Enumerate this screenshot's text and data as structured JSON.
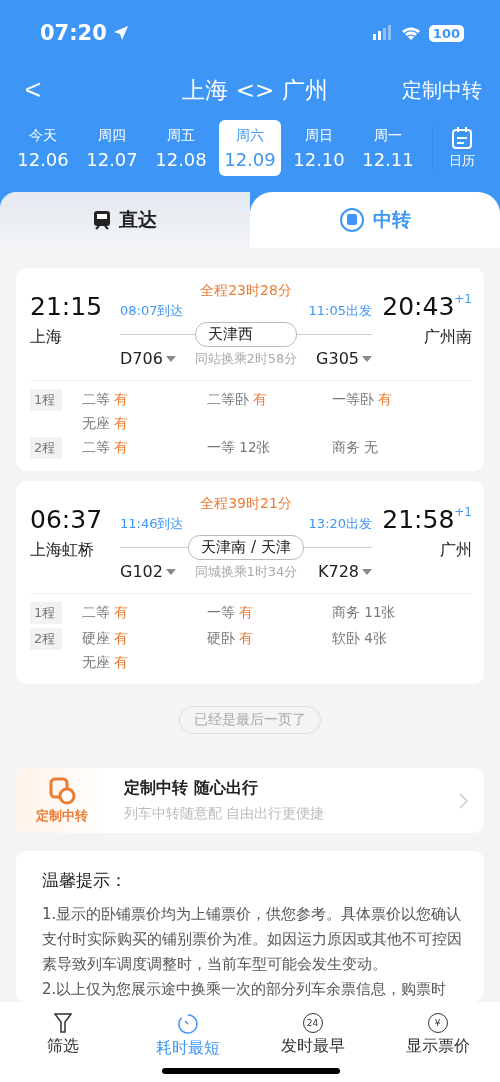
{
  "status_bar": {
    "time": "07:20",
    "battery": "100"
  },
  "header": {
    "back": "<",
    "title": "上海 <> 广州",
    "action": "定制中转"
  },
  "dates": [
    {
      "weekday": "今天",
      "date": "12.06",
      "selected": false
    },
    {
      "weekday": "周四",
      "date": "12.07",
      "selected": false
    },
    {
      "weekday": "周五",
      "date": "12.08",
      "selected": false
    },
    {
      "weekday": "周六",
      "date": "12.09",
      "selected": true
    },
    {
      "weekday": "周日",
      "date": "12.10",
      "selected": false
    },
    {
      "weekday": "周一",
      "date": "12.11",
      "selected": false
    }
  ],
  "calendar": {
    "label": "日历"
  },
  "tabs": [
    {
      "label": "直达",
      "selected": false
    },
    {
      "label": "中转",
      "selected": true
    }
  ],
  "trips": [
    {
      "depart_time": "21:15",
      "depart_station": "上海",
      "arrive_time": "20:43",
      "day_offset": "+1",
      "arrive_station": "广州南",
      "total": "全程23时28分",
      "leg1_arrive": "08:07到达",
      "leg1_train": "D706",
      "transfer_station": "天津西",
      "leg2_depart": "11:05出发",
      "leg2_train": "G305",
      "transfer_note": "同站换乘2时58分",
      "legs": [
        {
          "label": "1程",
          "seats": [
            {
              "class": "二等",
              "status": "有",
              "available": true
            },
            {
              "class": "二等卧",
              "status": "有",
              "available": true
            },
            {
              "class": "一等卧",
              "status": "有",
              "available": true
            },
            {
              "class": "无座",
              "status": "有",
              "available": true
            }
          ]
        },
        {
          "label": "2程",
          "seats": [
            {
              "class": "二等",
              "status": "有",
              "available": true
            },
            {
              "class": "一等",
              "status": "12张",
              "available": false
            },
            {
              "class": "商务",
              "status": "无",
              "available": false
            }
          ]
        }
      ]
    },
    {
      "depart_time": "06:37",
      "depart_station": "上海虹桥",
      "arrive_time": "21:58",
      "day_offset": "+1",
      "arrive_station": "广州",
      "total": "全程39时21分",
      "leg1_arrive": "11:46到达",
      "leg1_train": "G102",
      "transfer_station": "天津南 / 天津",
      "leg2_depart": "13:20出发",
      "leg2_train": "K728",
      "transfer_note": "同城换乘1时34分",
      "legs": [
        {
          "label": "1程",
          "seats": [
            {
              "class": "二等",
              "status": "有",
              "available": true
            },
            {
              "class": "一等",
              "status": "有",
              "available": true
            },
            {
              "class": "商务",
              "status": "11张",
              "available": false
            }
          ]
        },
        {
          "label": "2程",
          "seats": [
            {
              "class": "硬座",
              "status": "有",
              "available": true
            },
            {
              "class": "硬卧",
              "status": "有",
              "available": true
            },
            {
              "class": "软卧",
              "status": "4张",
              "available": false
            },
            {
              "class": "无座",
              "status": "有",
              "available": true
            }
          ]
        }
      ]
    }
  ],
  "end_note": "已经是最后一页了",
  "promo": {
    "badge": "定制中转",
    "title": "定制中转 随心出行",
    "subtitle": "列车中转随意配 自由出行更便捷"
  },
  "tips": {
    "title": "温馨提示：",
    "paragraphs": [
      "1.显示的卧铺票价均为上铺票价，供您参考。具体票价以您确认支付时实际购买的铺别票价为准。如因运力原因或其他不可控因素导致列车调度调整时，当前车型可能会发生变动。",
      "2.以上仅为您展示途中换乘一次的部分列车余票信息，购票时"
    ]
  },
  "bottom_bar": [
    {
      "kind": "filter",
      "label": "筛选",
      "selected": false
    },
    {
      "kind": "timer",
      "label": "耗时最短",
      "selected": true
    },
    {
      "kind": "clock",
      "label": "发时最早",
      "icon_text": "24",
      "selected": false
    },
    {
      "kind": "price",
      "label": "显示票价",
      "icon_text": "¥",
      "selected": false
    }
  ]
}
